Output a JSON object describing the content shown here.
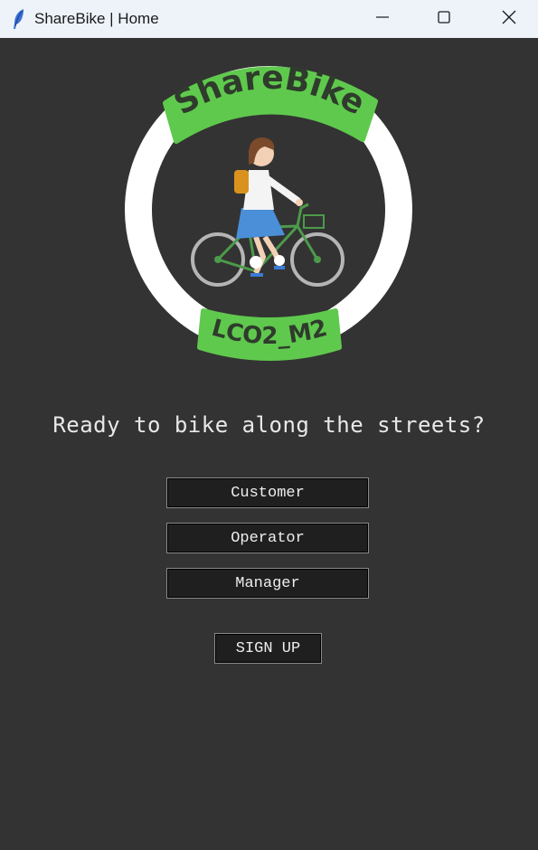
{
  "window": {
    "title": "ShareBike | Home",
    "app_icon": "feather-icon",
    "controls": [
      "minimize-icon",
      "maximize-icon",
      "close-icon"
    ]
  },
  "logo": {
    "top_banner": "ShareBike",
    "bottom_banner": "LCO2_M2",
    "illustration": "girl-riding-bicycle",
    "colors": {
      "banner": "#5fc94d",
      "ring": "#ffffff",
      "banner_text": "#2f3b2c"
    }
  },
  "main": {
    "tagline": "Ready to bike along the streets?",
    "buttons": {
      "customer": "Customer",
      "operator": "Operator",
      "manager": "Manager",
      "signup": "SIGN UP"
    }
  },
  "colors": {
    "background": "#333333",
    "button_bg": "#1f1f1f",
    "button_text": "#eeeeee",
    "titlebar": "#eef3f9"
  }
}
